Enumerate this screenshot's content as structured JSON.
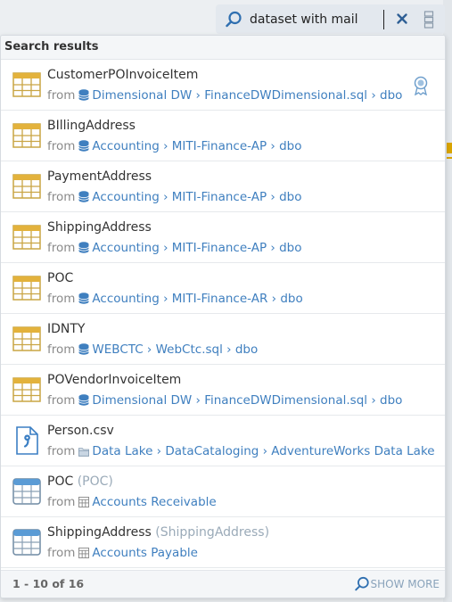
{
  "search": {
    "value": "dataset with mail",
    "clear_icon": "close-icon",
    "filter_icon": "filter-icon"
  },
  "panel": {
    "title": "Search results",
    "pagination": "1 - 10 of 16",
    "show_more_label": "SHOW MORE"
  },
  "from_label": "from",
  "results": [
    {
      "title": "CustomerPOInvoiceItem",
      "alias": "",
      "icon": "dataset-table-icon",
      "path_icon": "database-icon",
      "path": "Dimensional DW › FinanceDWDimensional.sql › dbo",
      "certified": true
    },
    {
      "title": "BIllingAddress",
      "alias": "",
      "icon": "dataset-table-icon",
      "path_icon": "database-icon",
      "path": "Accounting › MITI-Finance-AP › dbo",
      "certified": false
    },
    {
      "title": "PaymentAddress",
      "alias": "",
      "icon": "dataset-table-icon",
      "path_icon": "database-icon",
      "path": "Accounting › MITI-Finance-AP › dbo",
      "certified": false
    },
    {
      "title": "ShippingAddress",
      "alias": "",
      "icon": "dataset-table-icon",
      "path_icon": "database-icon",
      "path": "Accounting › MITI-Finance-AP › dbo",
      "certified": false
    },
    {
      "title": "POC",
      "alias": "",
      "icon": "dataset-table-icon",
      "path_icon": "database-icon",
      "path": "Accounting › MITI-Finance-AR › dbo",
      "certified": false
    },
    {
      "title": "IDNTY",
      "alias": "",
      "icon": "dataset-table-icon",
      "path_icon": "database-icon",
      "path": "WEBCTC › WebCtc.sql › dbo",
      "certified": false
    },
    {
      "title": "POVendorInvoiceItem",
      "alias": "",
      "icon": "dataset-table-icon",
      "path_icon": "database-icon",
      "path": "Dimensional DW › FinanceDWDimensional.sql › dbo",
      "certified": false
    },
    {
      "title": "Person.csv",
      "alias": "",
      "icon": "csv-file-icon",
      "path_icon": "folder-icon",
      "path": "Data Lake › DataCataloging › AdventureWorks Data Lake › Pe",
      "certified": false
    },
    {
      "title": "POC",
      "alias": "(POC)",
      "icon": "term-table-icon",
      "path_icon": "glossary-icon",
      "path": "Accounts Receivable",
      "certified": false
    },
    {
      "title": "ShippingAddress",
      "alias": "(ShippingAddress)",
      "icon": "term-table-icon",
      "path_icon": "glossary-icon",
      "path": "Accounts Payable",
      "certified": false
    }
  ],
  "colors": {
    "accent": "#3f7fbf",
    "table_icon_yellow": "#e3b23c",
    "term_icon_blue": "#5a9bd5"
  }
}
